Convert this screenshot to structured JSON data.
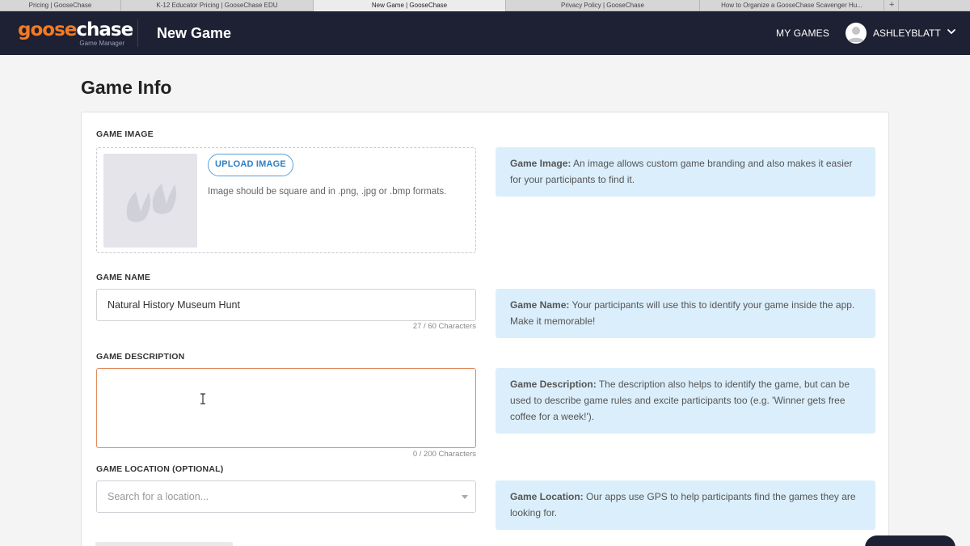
{
  "browser": {
    "tabs": [
      {
        "label": "Pricing | GooseChase",
        "width": 150,
        "active": false
      },
      {
        "label": "K-12 Educator Pricing | GooseChase EDU",
        "width": 238,
        "active": false
      },
      {
        "label": "New Game | GooseChase",
        "width": 238,
        "active": true
      },
      {
        "label": "Privacy Policy | GooseChase",
        "width": 240,
        "active": false
      },
      {
        "label": "How to Organize a GooseChase Scavenger Hu...",
        "width": 228,
        "active": false
      }
    ],
    "new_tab_label": "+"
  },
  "header": {
    "logo_goose": "goose",
    "logo_chase": "chase",
    "logo_sub": "Game Manager",
    "page_heading": "New Game",
    "my_games": "MY GAMES",
    "username": "ASHLEYBLATT"
  },
  "main": {
    "title": "Game Info",
    "game_image": {
      "label": "GAME IMAGE",
      "upload_button": "UPLOAD IMAGE",
      "hint": "Image should be square and in .png, .jpg or .bmp formats.",
      "tip_bold": "Game Image:",
      "tip_text": " An image allows custom game branding and also makes it easier for your participants to find it."
    },
    "game_name": {
      "label": "GAME NAME",
      "value": "Natural History Museum Hunt",
      "count": "27 / 60 Characters",
      "tip_bold": "Game Name:",
      "tip_text": " Your participants will use this to identify your game inside the app. Make it memorable!"
    },
    "game_description": {
      "label": "GAME DESCRIPTION",
      "value": "",
      "count": "0 / 200 Characters",
      "tip_bold": "Game Description:",
      "tip_text": " The description also helps to identify the game, but can be used to describe game rules and excite participants too (e.g. 'Winner gets free coffee for a week!')."
    },
    "game_location": {
      "label": "GAME LOCATION (OPTIONAL)",
      "placeholder": "Search for a location...",
      "tip_bold": "Game Location:",
      "tip_text": " Our apps use GPS to help participants find the games they are looking for."
    }
  },
  "colors": {
    "header_bg": "#1e2033",
    "accent_orange": "#f47a20",
    "link_blue": "#2f7fc1",
    "tip_bg": "#dbeefb",
    "focus_border": "#e08a5c"
  },
  "icons": {
    "avatar": "user-avatar-icon",
    "user_menu": "chevron-down-icon",
    "placeholder": "goose-footprint-icon",
    "select": "caret-down-icon",
    "cursor": "text-cursor-icon"
  }
}
